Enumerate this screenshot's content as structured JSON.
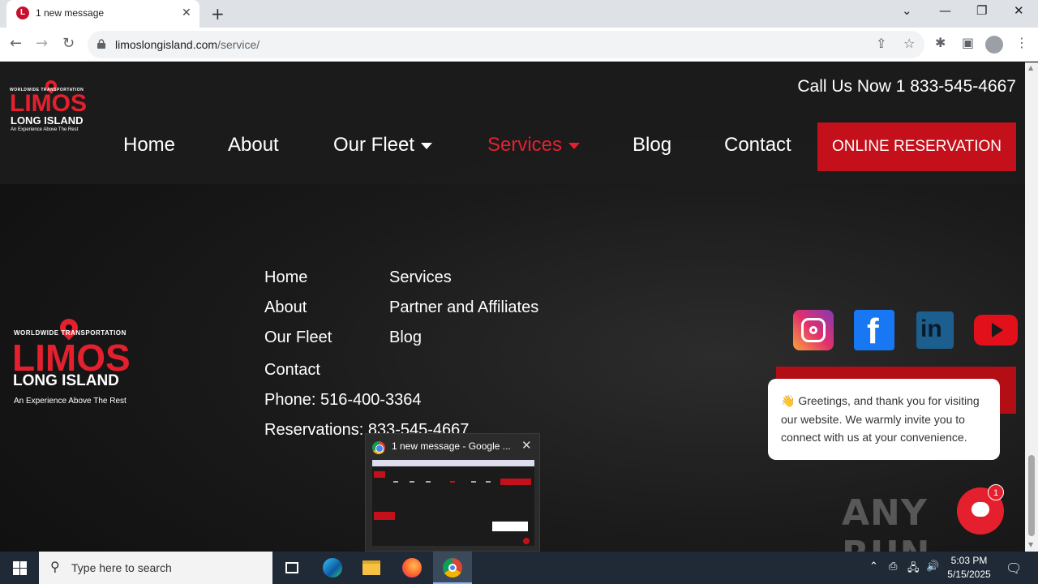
{
  "browser": {
    "tab_title": "1 new message",
    "tab_favicon_letter": "L",
    "url_host": "limoslongisland.com",
    "url_path": "/service/"
  },
  "header": {
    "logo": {
      "top": "WORLDWIDE  TRANSPORTATION",
      "main": "LIMOS",
      "sub": "LONG ISLAND",
      "tag": "An Experience Above The Rest"
    },
    "call_now": "Call Us Now 1 833-545-4667",
    "nav": [
      {
        "label": "Home"
      },
      {
        "label": "About"
      },
      {
        "label": "Our Fleet"
      },
      {
        "label": "Services"
      },
      {
        "label": "Blog"
      },
      {
        "label": "Contact"
      }
    ],
    "reserve_label": "ONLINE RESERVATION"
  },
  "footer": {
    "col1": [
      "Home",
      "About",
      "Our Fleet",
      "Contact"
    ],
    "col2": [
      "Services",
      "Partner and Affiliates",
      "Blog"
    ],
    "phone": "Phone: 516-400-3364",
    "reservations": "Reservations: 833-545-4667",
    "social": [
      "instagram-icon",
      "facebook-icon",
      "linkedin-icon",
      "youtube-icon"
    ]
  },
  "chat": {
    "greeting": "👋 Greetings, and thank you for visiting our website. We warmly invite you to connect with us at your convenience.",
    "badge": "1"
  },
  "preview": {
    "title": "1 new message - Google ..."
  },
  "taskbar": {
    "search_placeholder": "Type here to search",
    "time": "5:03 PM",
    "date": "5/15/2025"
  },
  "watermark": "ANY RUN",
  "colors": {
    "brand_red": "#e5202e",
    "button_red": "#c4101a"
  }
}
